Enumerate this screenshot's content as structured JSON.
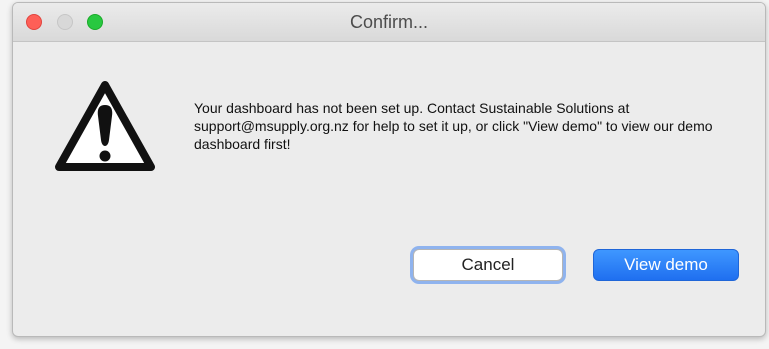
{
  "window": {
    "title": "Confirm..."
  },
  "dialog": {
    "icon": "warning-icon",
    "message": "Your dashboard has not been set up. Contact Sustainable Solutions at support@msupply.org.nz for help to set it up, or click \"View demo\" to view our demo dashboard first!"
  },
  "buttons": {
    "cancel_label": "Cancel",
    "view_demo_label": "View demo"
  },
  "colors": {
    "close": "#fe5f57",
    "minimize": "#d8d8d8",
    "maximize": "#28c840",
    "primary_button": "#2b7ff7",
    "focus_ring": "#8fb3ee"
  }
}
